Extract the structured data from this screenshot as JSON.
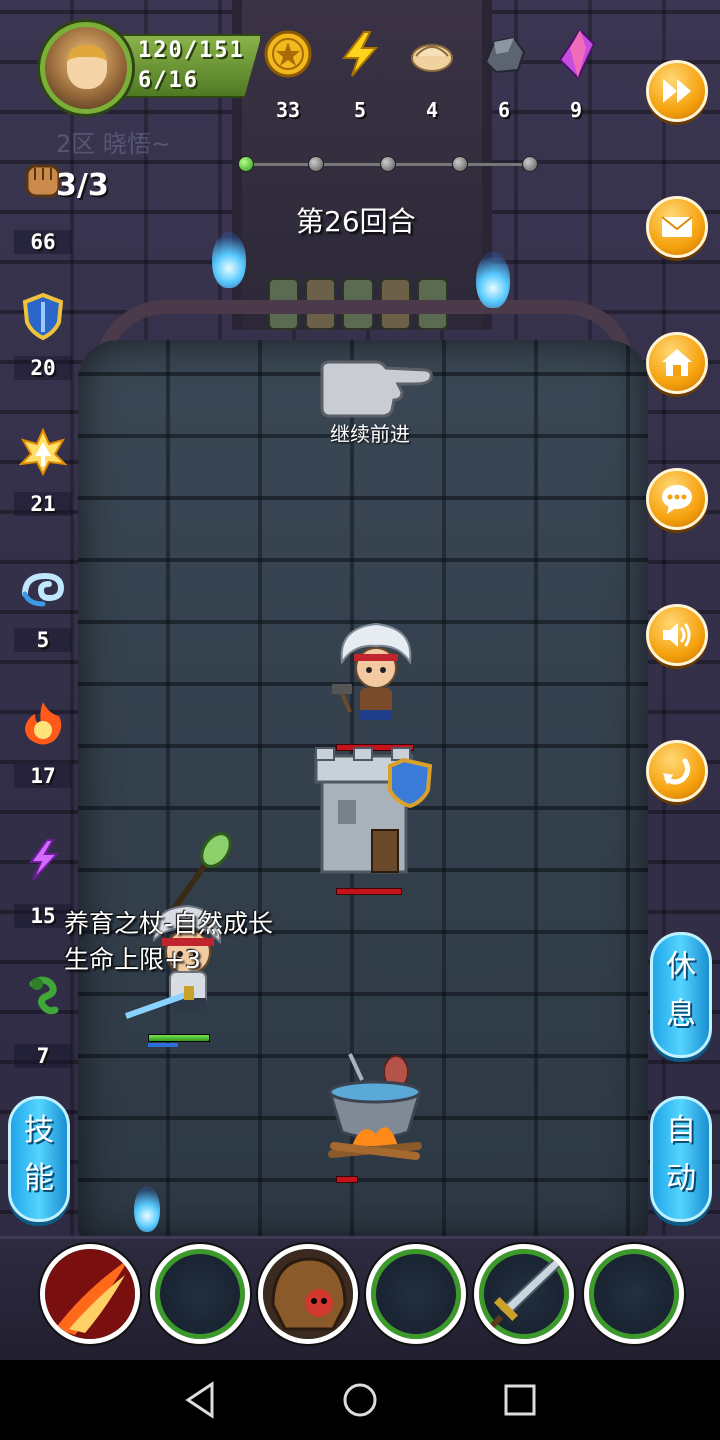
{
  "player": {
    "hp": "120/151",
    "floor": "6/16"
  },
  "resources": [
    {
      "icon": "gold-coin-icon",
      "value": "33"
    },
    {
      "icon": "lightning-energy-icon",
      "value": "5"
    },
    {
      "icon": "dumpling-icon",
      "value": "4"
    },
    {
      "icon": "iron-ore-icon",
      "value": "6"
    },
    {
      "icon": "purple-crystal-icon",
      "value": "9"
    }
  ],
  "faint_banner": "2区 晓悟~",
  "round_label": "第26回合",
  "continue_label": "继续前进",
  "attacks": "3/3",
  "stats": {
    "attack": "66",
    "defense": "20",
    "holy": "21",
    "water": "5",
    "fire": "17",
    "lightning": "15",
    "poison": "7"
  },
  "floating_text": {
    "line1": "养育之杖-自然成长",
    "line2": "生命上限+3"
  },
  "buttons": {
    "rest": {
      "line1": "休",
      "line2": "息"
    },
    "skills": {
      "line1": "技",
      "line2": "能"
    },
    "auto": {
      "line1": "自",
      "line2": "动"
    }
  },
  "colors": {
    "accent_orange": "#f6a20f",
    "accent_blue": "#1fa6e8",
    "health_green": "#3c9a2a",
    "enemy_hp_red": "#c3141b"
  }
}
